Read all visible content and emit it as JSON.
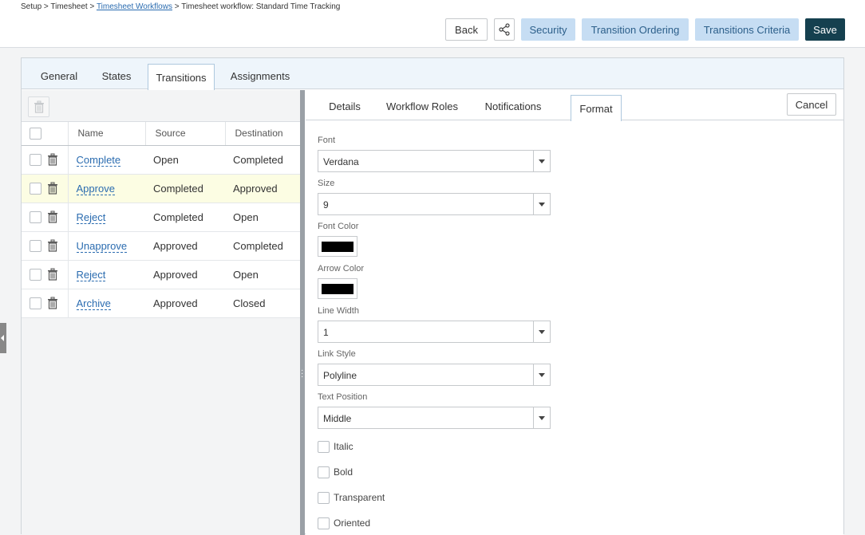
{
  "breadcrumb": {
    "setup": "Setup",
    "sep": ">",
    "timesheet": "Timesheet",
    "workflows": "Timesheet Workflows",
    "current": "Timesheet workflow: Standard Time Tracking"
  },
  "header_buttons": {
    "back": "Back",
    "security": "Security",
    "transition_ordering": "Transition Ordering",
    "transitions_criteria": "Transitions Criteria",
    "save": "Save"
  },
  "main_tabs": [
    "General",
    "States",
    "Transitions",
    "Assignments"
  ],
  "grid": {
    "columns": [
      "Name",
      "Source",
      "Destination"
    ],
    "rows": [
      {
        "name": "Complete",
        "source": "Open",
        "destination": "Completed"
      },
      {
        "name": "Approve",
        "source": "Completed",
        "destination": "Approved"
      },
      {
        "name": "Reject",
        "source": "Completed",
        "destination": "Open"
      },
      {
        "name": "Unapprove",
        "source": "Approved",
        "destination": "Completed"
      },
      {
        "name": "Reject",
        "source": "Approved",
        "destination": "Open"
      },
      {
        "name": "Archive",
        "source": "Approved",
        "destination": "Closed"
      }
    ]
  },
  "detail_tabs": [
    "Details",
    "Workflow Roles",
    "Notifications",
    "Format"
  ],
  "cancel": "Cancel",
  "format": {
    "font_label": "Font",
    "font_value": "Verdana",
    "size_label": "Size",
    "size_value": "9",
    "font_color_label": "Font Color",
    "arrow_color_label": "Arrow Color",
    "line_width_label": "Line Width",
    "line_width_value": "1",
    "link_style_label": "Link Style",
    "link_style_value": "Polyline",
    "text_position_label": "Text Position",
    "text_position_value": "Middle",
    "italic": "Italic",
    "bold": "Bold",
    "transparent": "Transparent",
    "oriented": "Oriented"
  },
  "colors": {
    "accent_dark": "#15404f",
    "accent_light": "#c6ddf3",
    "link": "#2b6cb0",
    "font_color": "#000000",
    "arrow_color": "#000000",
    "highlight_row": "#fcfde3"
  }
}
